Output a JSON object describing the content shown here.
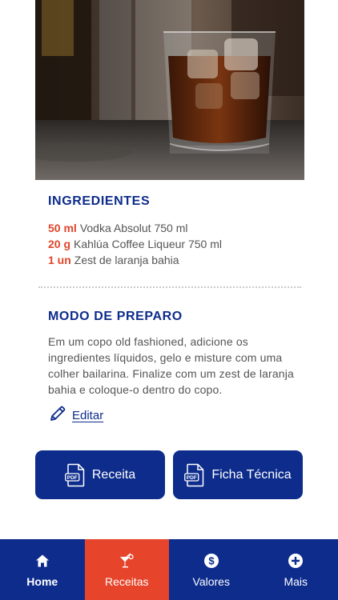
{
  "hero": {
    "image": "drink-photo-rocks-glass"
  },
  "ingredients": {
    "title": "INGREDIENTES",
    "items": [
      {
        "qty": "50 ml",
        "name": "Vodka Absolut 750 ml"
      },
      {
        "qty": "20 g",
        "name": "Kahlúa Coffee Liqueur 750 ml"
      },
      {
        "qty": "1 un",
        "name": "Zest de laranja bahia"
      }
    ]
  },
  "preparation": {
    "title": "MODO DE PREPARO",
    "text": "Em um copo old fashioned, adicione os ingredientes líquidos, gelo e misture com uma colher bailarina. Finalize com um zest de laranja bahia e coloque-o dentro do copo."
  },
  "edit": {
    "label": "Editar",
    "icon": "pencil-icon"
  },
  "actions": {
    "receita": {
      "label": "Receita",
      "icon": "pdf-icon"
    },
    "ficha": {
      "label": "Ficha Técnica",
      "icon": "pdf-icon"
    }
  },
  "tabbar": {
    "items": [
      {
        "label": "Home",
        "icon": "home-icon"
      },
      {
        "label": "Receitas",
        "icon": "cocktail-icon",
        "active": true
      },
      {
        "label": "Valores",
        "icon": "dollar-icon"
      },
      {
        "label": "Mais",
        "icon": "plus-icon"
      }
    ]
  },
  "colors": {
    "primary": "#0d2c8c",
    "accent": "#e6452b",
    "text": "#555555"
  }
}
